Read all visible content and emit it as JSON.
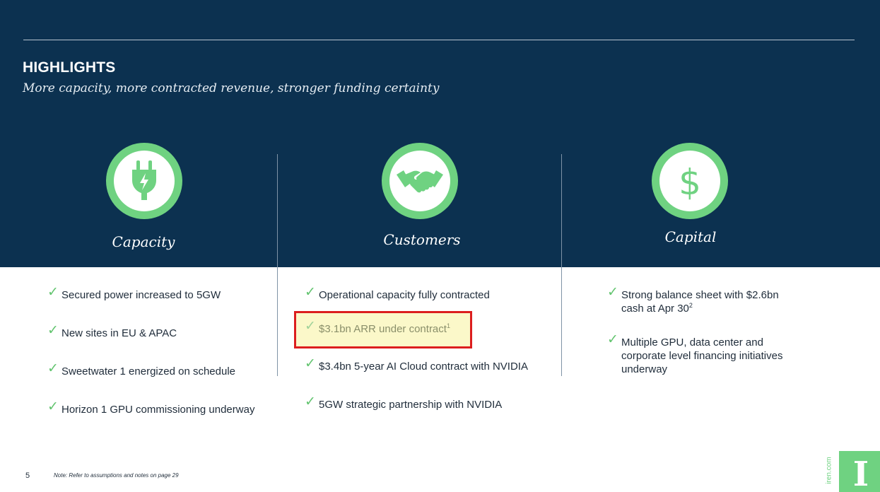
{
  "header": {
    "title": "HIGHLIGHTS",
    "subtitle": "More capacity, more contracted revenue, stronger funding certainty"
  },
  "columns": [
    {
      "title": "Capacity",
      "icon": "power-plug-icon",
      "items": [
        {
          "text": "Secured power increased to 5GW"
        },
        {
          "text": "New sites in EU & APAC"
        },
        {
          "text": "Sweetwater 1 energized on schedule"
        },
        {
          "text": "Horizon 1 GPU commissioning underway"
        }
      ]
    },
    {
      "title": "Customers",
      "icon": "handshake-icon",
      "items": [
        {
          "text": "Operational capacity fully contracted"
        },
        {
          "text": "$3.1bn ARR under contract",
          "sup": "1"
        },
        {
          "text": "$3.4bn 5-year AI Cloud contract with NVIDIA"
        },
        {
          "text": "5GW strategic partnership with NVIDIA"
        }
      ]
    },
    {
      "title": "Capital",
      "icon": "dollar-sign-icon",
      "items": [
        {
          "line1": "Strong balance sheet with $2.6bn",
          "line2": "cash at Apr 30",
          "sup": "2"
        },
        {
          "line1": "Multiple GPU, data center and",
          "line2": "corporate level financing initiatives",
          "line3": "underway"
        }
      ]
    }
  ],
  "footer": {
    "page_number": "5",
    "note": "Note: Refer to assumptions and notes on page 29",
    "website": "iren.com",
    "logo_letter": "I"
  },
  "colors": {
    "navy": "#0c3150",
    "green": "#6fd281",
    "highlight_border": "#dc1e1e",
    "highlight_fill": "#fbf8c9"
  }
}
